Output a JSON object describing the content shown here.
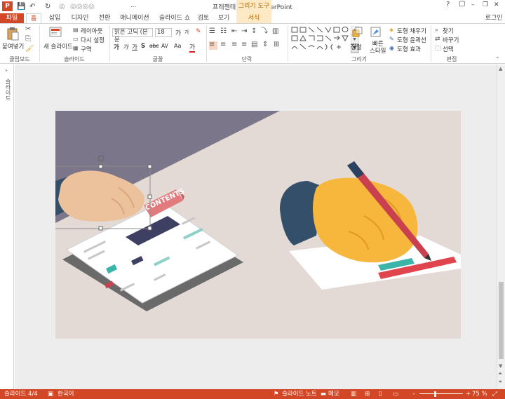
{
  "window": {
    "app_logo": "P",
    "title": "프레젠테이션2 - PowerPoint",
    "context_tool": "그리기 도구",
    "minimize": "–",
    "restore": "❐",
    "close": "✕",
    "help": "?"
  },
  "quick_access": {
    "save": "💾",
    "undo": "↶",
    "redo": "↻",
    "more": "⋯"
  },
  "tabs": [
    {
      "label": "파일"
    },
    {
      "label": "홈"
    },
    {
      "label": "삽입"
    },
    {
      "label": "디자인"
    },
    {
      "label": "전환"
    },
    {
      "label": "애니메이션"
    },
    {
      "label": "슬라이드 쇼"
    },
    {
      "label": "검토"
    },
    {
      "label": "보기"
    },
    {
      "label": "서식"
    }
  ],
  "login": "로그인",
  "ribbon": {
    "clipboard": {
      "paste": "붙여넣기",
      "group": "클립보드"
    },
    "slides": {
      "new_slide": "새 슬라이드",
      "layout": "레이아웃",
      "reset": "다시 설정",
      "section": "구역",
      "group": "슬라이드"
    },
    "font": {
      "font_name": "맑은 고딕 (본문",
      "font_size": "18",
      "bold": "가",
      "italic": "가",
      "underline": "가",
      "strike": "abc",
      "shadow": "S",
      "spacing": "AV",
      "case": "가나",
      "color": "가",
      "clear": "Aa",
      "grow": "가",
      "shrink": "가",
      "group": "글꼴"
    },
    "paragraph": {
      "group": "단락"
    },
    "drawing": {
      "arrange": "정렬",
      "quick_styles": "빠른\n스타일",
      "shape_fill": "도형 채우기",
      "shape_outline": "도형 윤곽선",
      "shape_effects": "도형 효과",
      "group": "그리기"
    },
    "editing": {
      "find": "찾기",
      "replace": "바꾸기",
      "select": "선택",
      "group": "편집"
    }
  },
  "left_pane": {
    "label": "슬라이드"
  },
  "slide": {
    "banner_text": "CONTENTS"
  },
  "status": {
    "slide_info": "슬라이드 4/4",
    "language": "한국어",
    "notes": "슬라이드 노트",
    "comments": "메모",
    "zoom": "75 %",
    "zoom_level_percent": 75,
    "zoom_minus": "–",
    "zoom_plus": "+"
  },
  "colors": {
    "accent": "#d24726",
    "slide_bg": "#e3dad6",
    "slide_dark": "#7b7689",
    "hand_yellow": "#f6b73c",
    "sleeve": "#344f69",
    "banner": "#e27b7d"
  }
}
